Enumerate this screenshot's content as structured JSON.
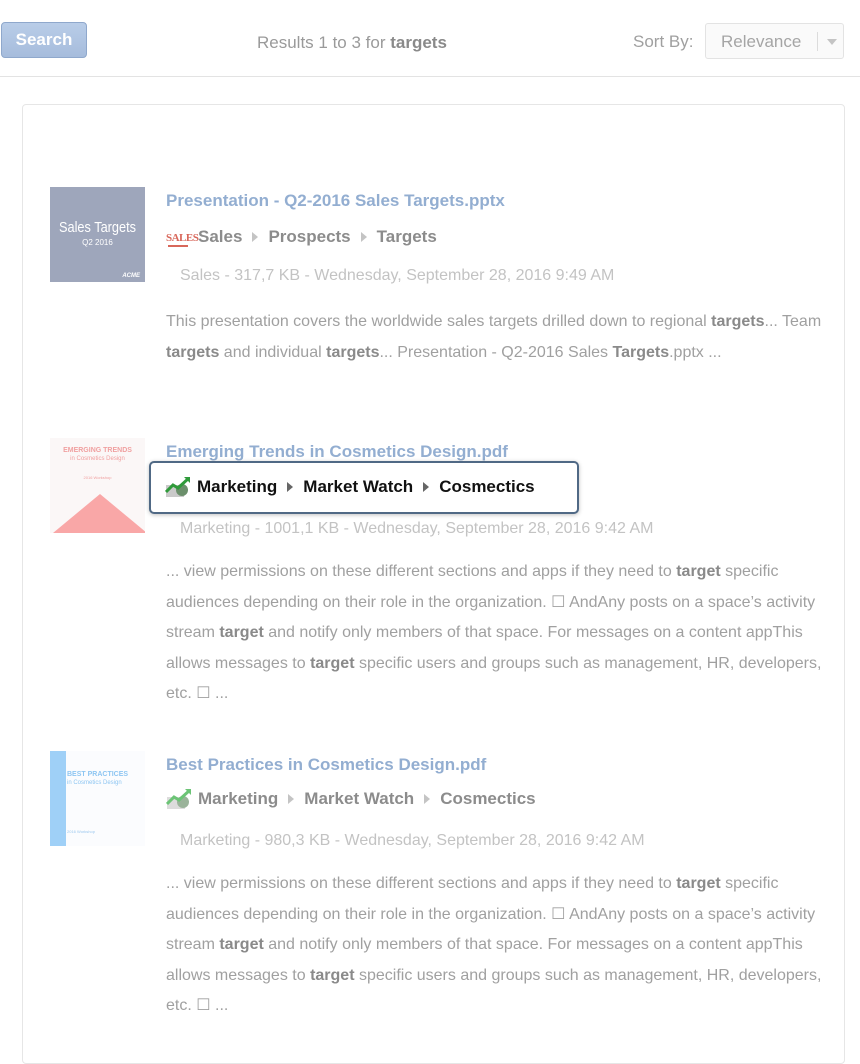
{
  "toolbar": {
    "search_label": "Search",
    "results_prefix": "Results 1 to 3 for ",
    "query": "targets",
    "sort_label": "Sort By:",
    "sort_value": "Relevance"
  },
  "results": [
    {
      "title": "Presentation - Q2-2016 Sales Targets.pptx",
      "thumbnail": {
        "line1": "Sales Targets",
        "line2": "Q2 2016",
        "line3": "ACME"
      },
      "space_icon": "sales-icon",
      "space_icon_text": "SALES",
      "breadcrumb": [
        "Sales",
        "Prospects",
        "Targets"
      ],
      "meta": "Sales - 317,7 KB - Wednesday, September 28, 2016 9:49 AM",
      "snippet": [
        {
          "text": "This presentation covers the worldwide sales targets drilled down to regional ",
          "bold": false
        },
        {
          "text": "targets",
          "bold": true
        },
        {
          "text": "... Team ",
          "bold": false
        },
        {
          "text": "targets",
          "bold": true
        },
        {
          "text": " and individual ",
          "bold": false
        },
        {
          "text": "targets",
          "bold": true
        },
        {
          "text": "... Presentation - Q2-2016 Sales ",
          "bold": false
        },
        {
          "text": "Targets",
          "bold": true
        },
        {
          "text": ".pptx ...",
          "bold": false
        }
      ]
    },
    {
      "title": "Emerging Trends in Cosmetics Design.pdf",
      "thumbnail": {
        "line1": "EMERGING TRENDS",
        "line2": "in Cosmetics Design",
        "line3": "2016 Workshop"
      },
      "space_icon": "marketing-chart-icon",
      "breadcrumb": [
        "Marketing",
        "Market Watch",
        "Cosmectics"
      ],
      "meta": "Marketing - 1001,1 KB - Wednesday, September 28, 2016 9:42 AM",
      "snippet": [
        {
          "text": "... view permissions on these different sections and apps if they need to ",
          "bold": false
        },
        {
          "text": "target",
          "bold": true
        },
        {
          "text": " specific audiences depending on their role in the organization. ☐ AndAny posts on a space’s activity stream ",
          "bold": false
        },
        {
          "text": "target",
          "bold": true
        },
        {
          "text": " and notify only members of that space. For messages on a content appThis allows messages to ",
          "bold": false
        },
        {
          "text": "target",
          "bold": true
        },
        {
          "text": " specific users and groups such as management, HR, developers, etc. ☐ ...",
          "bold": false
        }
      ]
    },
    {
      "title": "Best Practices in Cosmetics Design.pdf",
      "thumbnail": {
        "line1": "BEST PRACTICES",
        "line2": "in Cosmetics Design",
        "line3": "2016 Workshop"
      },
      "space_icon": "marketing-chart-icon",
      "breadcrumb": [
        "Marketing",
        "Market Watch",
        "Cosmectics"
      ],
      "meta": "Marketing - 980,3 KB - Wednesday, September 28, 2016 9:42 AM",
      "snippet": [
        {
          "text": "... view permissions on these different sections and apps if they need to ",
          "bold": false
        },
        {
          "text": "target",
          "bold": true
        },
        {
          "text": " specific audiences depending on their role in the organization. ☐ AndAny posts on a space’s activity stream ",
          "bold": false
        },
        {
          "text": "target",
          "bold": true
        },
        {
          "text": " and notify only members of that space. For messages on a content appThis allows messages to ",
          "bold": false
        },
        {
          "text": "target",
          "bold": true
        },
        {
          "text": " specific users and groups such as management, HR, developers, etc. ☐ ...",
          "bold": false
        }
      ]
    }
  ],
  "colors": {
    "link": "#93aed1",
    "button": "#a6bcdc",
    "focus_border": "#506985"
  }
}
